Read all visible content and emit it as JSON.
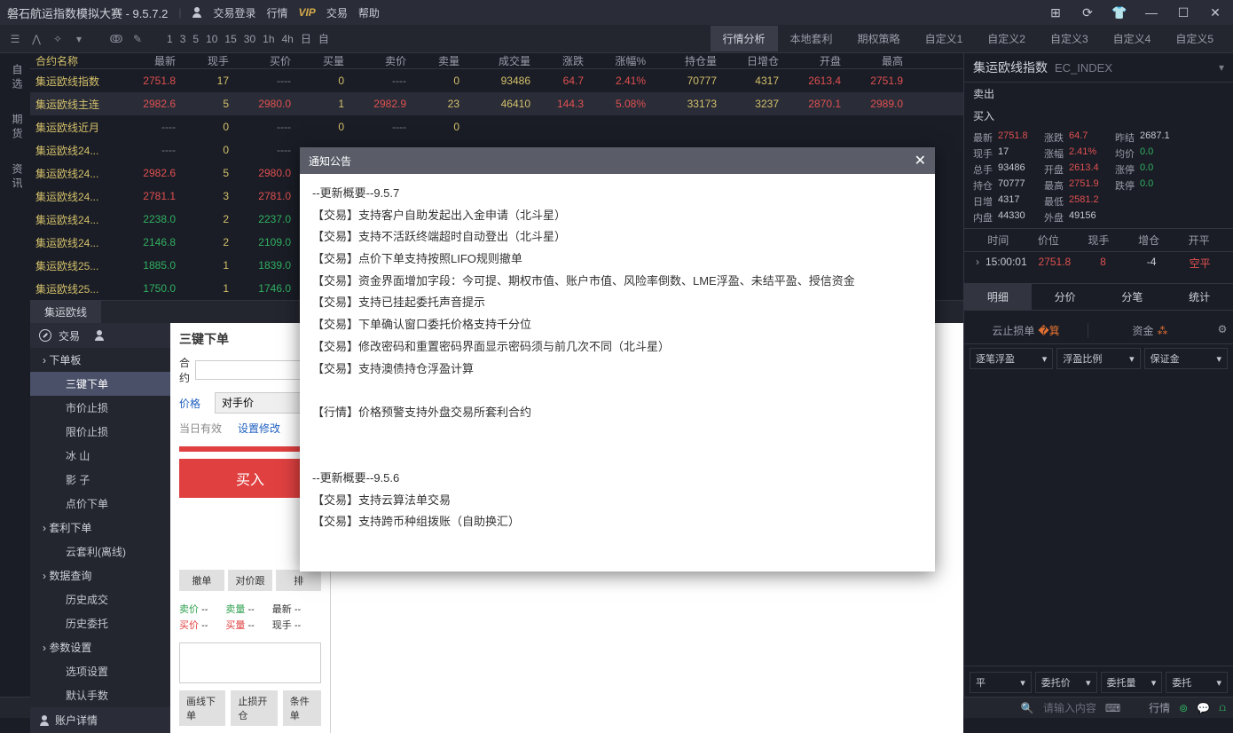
{
  "titlebar": {
    "title": "磐石航运指数模拟大赛 - 9.5.7.2",
    "login": "交易登录",
    "menu1": "行情",
    "vip": "VIP",
    "menu2": "交易",
    "menu3": "帮助"
  },
  "toolbar": {
    "timeframes": [
      "1",
      "3",
      "5",
      "10",
      "15",
      "30",
      "1h",
      "4h",
      "日",
      "自"
    ],
    "navtabs": [
      "行情分析",
      "本地套利",
      "期权策略",
      "自定义1",
      "自定义2",
      "自定义3",
      "自定义4",
      "自定义5"
    ]
  },
  "leftTabs": [
    "自选",
    "期货",
    "资讯"
  ],
  "gridHead": [
    "合约名称",
    "最新",
    "现手",
    "买价",
    "买量",
    "卖价",
    "卖量",
    "成交量",
    "涨跌",
    "涨幅%",
    "持仓量",
    "日增仓",
    "开盘",
    "最高"
  ],
  "gridRows": [
    {
      "name": "集运欧线指数",
      "v": [
        "2751.8",
        "17",
        "----",
        "0",
        "----",
        "0",
        "93486",
        "64.7",
        "2.41%",
        "70777",
        "4317",
        "2613.4",
        "2751.9"
      ],
      "cls": [
        "red",
        "orange",
        "gray",
        "orange",
        "gray",
        "orange",
        "orange",
        "red",
        "red",
        "orange",
        "orange",
        "red",
        "red"
      ]
    },
    {
      "name": "集运欧线主连",
      "v": [
        "2982.6",
        "5",
        "2980.0",
        "1",
        "2982.9",
        "23",
        "46410",
        "144.3",
        "5.08%",
        "33173",
        "3237",
        "2870.1",
        "2989.0"
      ],
      "cls": [
        "red",
        "orange",
        "red",
        "orange",
        "red",
        "orange",
        "orange",
        "red",
        "red",
        "orange",
        "orange",
        "red",
        "red"
      ]
    },
    {
      "name": "集运欧线近月",
      "v": [
        "----",
        "0",
        "----",
        "0",
        "----",
        "0",
        "",
        "",
        "",
        "",
        "",
        "",
        ""
      ],
      "cls": [
        "gray",
        "orange",
        "gray",
        "orange",
        "gray",
        "orange",
        "",
        "",
        "",
        "",
        "",
        "",
        ""
      ]
    },
    {
      "name": "集运欧线24...",
      "v": [
        "----",
        "0",
        "----",
        "",
        "",
        "",
        "",
        "",
        "",
        "",
        "",
        "",
        ""
      ],
      "cls": [
        "gray",
        "orange",
        "gray",
        "",
        "",
        "",
        "",
        "",
        "",
        "",
        "",
        "",
        ""
      ]
    },
    {
      "name": "集运欧线24...",
      "v": [
        "2982.6",
        "5",
        "2980.0",
        "",
        "",
        "",
        "",
        "",
        "",
        "",
        "",
        "",
        ""
      ],
      "cls": [
        "red",
        "orange",
        "red",
        "",
        "",
        "",
        "",
        "",
        "",
        "",
        "",
        "",
        ""
      ]
    },
    {
      "name": "集运欧线24...",
      "v": [
        "2781.1",
        "3",
        "2781.0",
        "",
        "",
        "",
        "",
        "",
        "",
        "",
        "",
        "",
        ""
      ],
      "cls": [
        "red",
        "orange",
        "red",
        "",
        "",
        "",
        "",
        "",
        "",
        "",
        "",
        "",
        ""
      ]
    },
    {
      "name": "集运欧线24...",
      "v": [
        "2238.0",
        "2",
        "2237.0",
        "",
        "",
        "",
        "",
        "",
        "",
        "",
        "",
        "",
        ""
      ],
      "cls": [
        "green",
        "orange",
        "green",
        "",
        "",
        "",
        "",
        "",
        "",
        "",
        "",
        "",
        ""
      ]
    },
    {
      "name": "集运欧线24...",
      "v": [
        "2146.8",
        "2",
        "2109.0",
        "",
        "",
        "",
        "",
        "",
        "",
        "",
        "",
        "",
        ""
      ],
      "cls": [
        "green",
        "orange",
        "green",
        "",
        "",
        "",
        "",
        "",
        "",
        "",
        "",
        "",
        ""
      ]
    },
    {
      "name": "集运欧线25...",
      "v": [
        "1885.0",
        "1",
        "1839.0",
        "",
        "",
        "",
        "",
        "",
        "",
        "",
        "",
        "",
        ""
      ],
      "cls": [
        "green",
        "orange",
        "green",
        "",
        "",
        "",
        "",
        "",
        "",
        "",
        "",
        "",
        ""
      ]
    },
    {
      "name": "集运欧线25...",
      "v": [
        "1750.0",
        "1",
        "1746.0",
        "",
        "",
        "",
        "",
        "",
        "",
        "",
        "",
        "",
        ""
      ],
      "cls": [
        "green",
        "orange",
        "green",
        "",
        "",
        "",
        "",
        "",
        "",
        "",
        "",
        "",
        ""
      ]
    }
  ],
  "gridTab": "集运欧线",
  "trade": {
    "header": "交易",
    "tree": {
      "g1": "下单板",
      "g1items": [
        "三键下单",
        "市价止损",
        "限价止损",
        "冰 山",
        "影 子",
        "点价下单"
      ],
      "g2": "套利下单",
      "g2items": [
        "云套利(离线)"
      ],
      "g3": "数据查询",
      "g3items": [
        "历史成交",
        "历史委托"
      ],
      "g4": "参数设置",
      "g4items": [
        "选项设置",
        "默认手数"
      ],
      "acct": "账户详情"
    },
    "form": {
      "title": "三键下单",
      "contract": "合约",
      "price": "价格",
      "priceOpt": "对手价",
      "today": "当日有效",
      "setting": "设置修改",
      "buy": "买入",
      "btns": [
        "撤单",
        "对价跟",
        "排"
      ],
      "quotes": {
        "sellp": "卖价",
        "sellq": "卖量",
        "buyp": "买价",
        "buyq": "买量",
        "last": "最新",
        "vol": "现手",
        "dash": "--"
      },
      "lbtns": [
        "画线下单",
        "止损开仓",
        "条件单"
      ]
    }
  },
  "rightPanel": {
    "name": "集运欧线指数",
    "code": "EC_INDEX",
    "sell": "卖出",
    "buy": "买入",
    "stats": [
      [
        "最新",
        "2751.8",
        "red",
        "涨跌",
        "64.7",
        "red",
        "昨结",
        "2687.1",
        ""
      ],
      [
        "现手",
        "17",
        "",
        "涨幅",
        "2.41%",
        "red",
        "均价",
        "0.0",
        "green"
      ],
      [
        "总手",
        "93486",
        "",
        "开盘",
        "2613.4",
        "red",
        "涨停",
        "0.0",
        "green"
      ],
      [
        "持仓",
        "70777",
        "",
        "最高",
        "2751.9",
        "red",
        "跌停",
        "0.0",
        "green"
      ],
      [
        "日增",
        "4317",
        "",
        "最低",
        "2581.2",
        "red",
        "",
        "",
        ""
      ],
      [
        "内盘",
        "44330",
        "",
        "外盘",
        "49156",
        "",
        "",
        "",
        ""
      ]
    ],
    "tickHead": [
      "时间",
      "价位",
      "现手",
      "增仓",
      "开平"
    ],
    "tick": {
      "time": "15:00:01",
      "price": "2751.8",
      "vol": "8",
      "oi": "-4",
      "oc": "空平"
    },
    "tabs": [
      "明细",
      "分价",
      "分笔",
      "统计"
    ],
    "ptabs": [
      "云止损单",
      "资金"
    ],
    "pfilters": [
      "逐笔浮盈",
      "浮盈比例",
      "保证金"
    ],
    "pcol2": [
      "平",
      "委托价",
      "委托量",
      "委托"
    ]
  },
  "dialog": {
    "title": "通知公告",
    "lines": [
      "--更新概要--9.5.7",
      "【交易】支持客户自助发起出入金申请（北斗星）",
      "【交易】支持不活跃终端超时自动登出（北斗星）",
      "【交易】点价下单支持按照LIFO规则撤单",
      "【交易】资金界面增加字段：今可提、期权市值、账户市值、风险率倒数、LME浮盈、未结平盈、授信资金",
      "【交易】支持已挂起委托声音提示",
      "【交易】下单确认窗口委托价格支持千分位",
      "【交易】修改密码和重置密码界面显示密码须与前几次不同（北斗星）",
      "【交易】支持澳债持仓浮盈计算",
      "",
      "【行情】价格预警支持外盘交易所套利合约",
      "",
      "",
      "--更新概要--9.5.6",
      "【交易】支持云算法单交易",
      "【交易】支持跨币种组拨账（自助换汇）"
    ]
  },
  "statusbar": {
    "input": "请输入内容",
    "hq": "行情"
  }
}
